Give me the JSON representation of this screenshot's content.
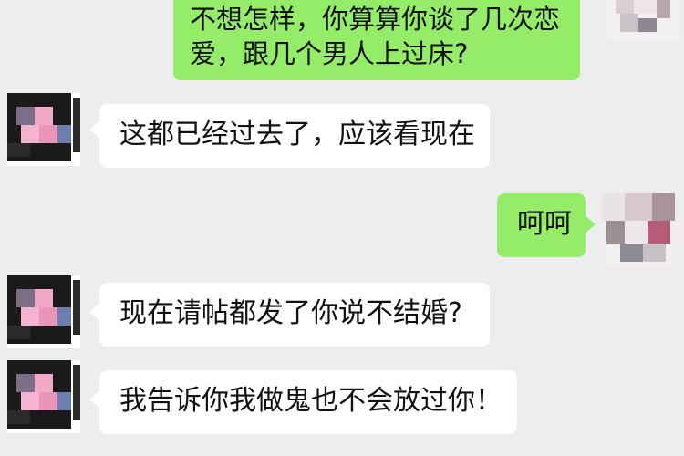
{
  "colors": {
    "background": "#ededed",
    "incoming_bubble": "#ffffff",
    "outgoing_bubble": "#95ec69",
    "text": "#111111"
  },
  "messages": [
    {
      "from": "self",
      "text_lines": [
        "不想怎样，你算算你谈了几次恋",
        "爱，跟几个男人上过床?"
      ]
    },
    {
      "from": "other",
      "text": "这都已经过去了，应该看现在"
    },
    {
      "from": "self",
      "text": "呵呵"
    },
    {
      "from": "other",
      "text": "现在请帖都发了你说不结婚?"
    },
    {
      "from": "other",
      "text": "我告诉你我做鬼也不会放过你！"
    }
  ]
}
